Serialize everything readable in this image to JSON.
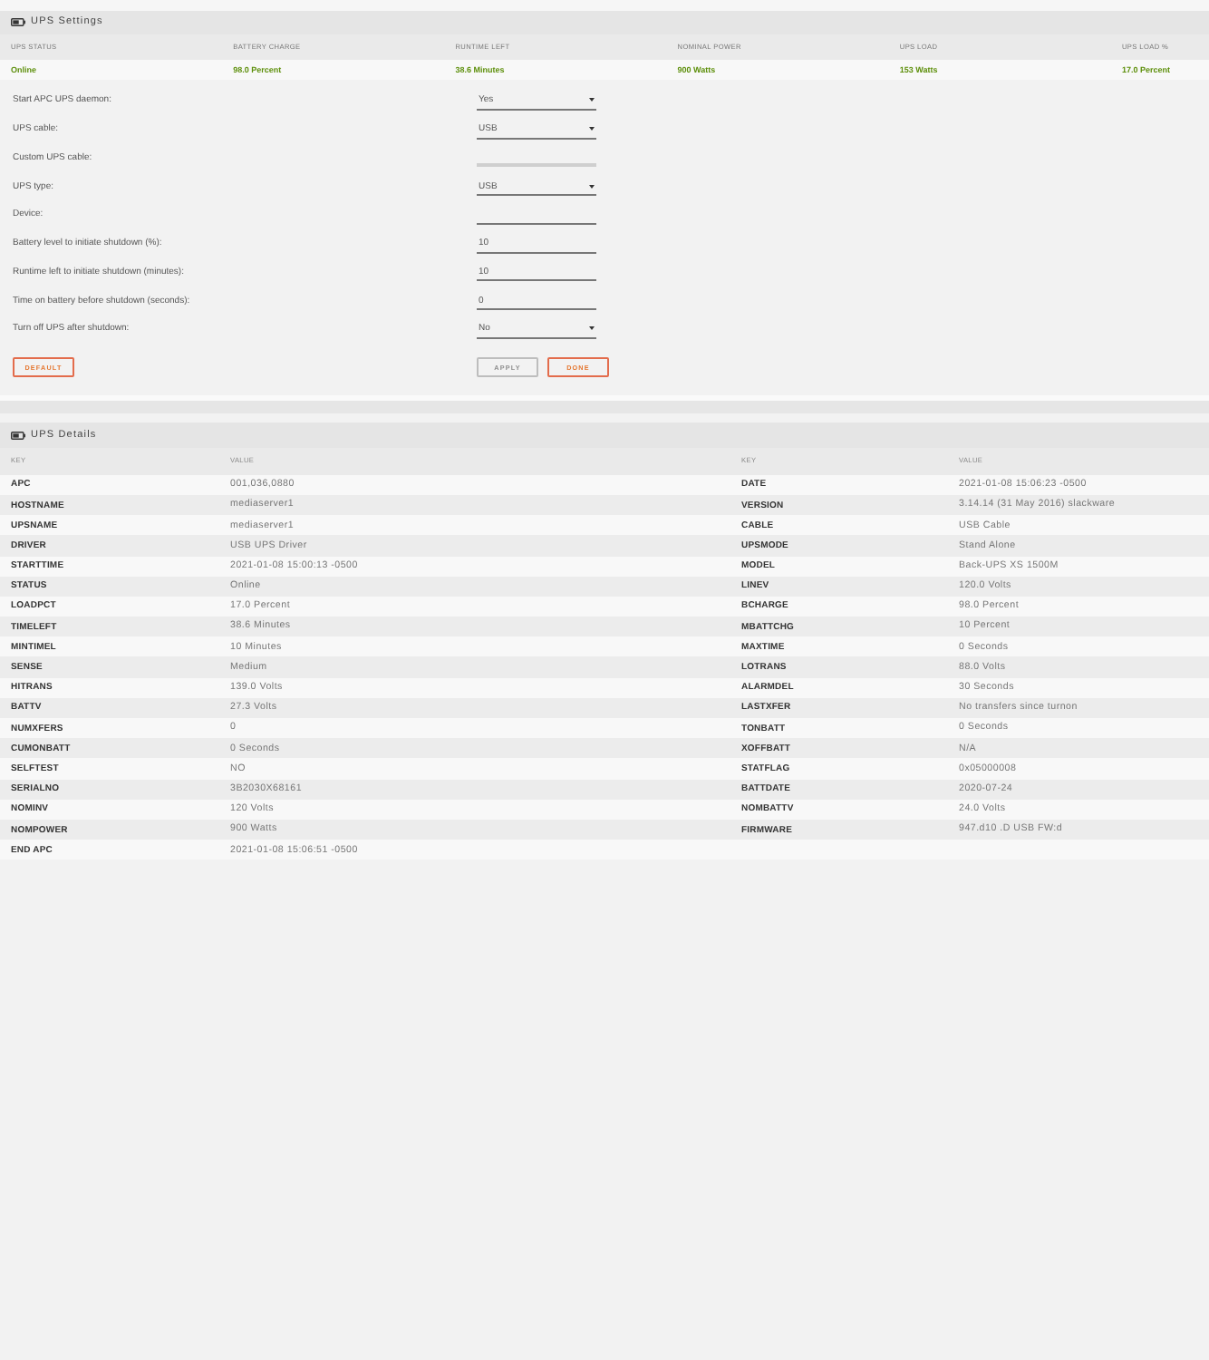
{
  "settings_panel": {
    "title": "UPS Settings",
    "status": [
      {
        "label": "UPS STATUS",
        "value": "Online"
      },
      {
        "label": "BATTERY CHARGE",
        "value": "98.0 Percent"
      },
      {
        "label": "RUNTIME LEFT",
        "value": "38.6 Minutes"
      },
      {
        "label": "NOMINAL POWER",
        "value": "900 Watts"
      },
      {
        "label": "UPS LOAD",
        "value": "153 Watts"
      },
      {
        "label": "UPS LOAD %",
        "value": "17.0 Percent"
      }
    ],
    "fields": [
      {
        "label": "Start APC UPS daemon:",
        "kind": "select",
        "value": "Yes",
        "disabled": false
      },
      {
        "label": "UPS cable:",
        "kind": "select",
        "value": "USB",
        "disabled": false
      },
      {
        "label": "Custom UPS cable:",
        "kind": "input",
        "disabled": true
      },
      {
        "label": "UPS type:",
        "kind": "select",
        "value": "USB",
        "disabled": false
      },
      {
        "label": "Device:",
        "kind": "input",
        "disabled": false
      },
      {
        "label": "Battery level to initiate shutdown (%):",
        "kind": "input",
        "value": "10",
        "disabled": false
      },
      {
        "label": "Runtime left to initiate shutdown (minutes):",
        "kind": "input",
        "value": "10",
        "disabled": false
      },
      {
        "label": "Time on battery before shutdown (seconds):",
        "kind": "input",
        "value": "0",
        "disabled": false
      },
      {
        "label": "Turn off UPS after shutdown:",
        "kind": "select",
        "value": "No",
        "disabled": false
      }
    ],
    "buttons": [
      {
        "label": "DEFAULT",
        "disabled": false
      },
      {
        "label": "APPLY",
        "disabled": true
      },
      {
        "label": "DONE",
        "disabled": false
      }
    ]
  },
  "details_panel": {
    "title": "UPS Details",
    "columns": [
      "KEY",
      "VALUE",
      "KEY",
      "VALUE"
    ],
    "rows": [
      {
        "cells": [
          "APC",
          "001,036,0880",
          "DATE",
          "2021-01-08 15:06:23 -0500"
        ]
      },
      {
        "cells": [
          "HOSTNAME",
          "mediaserver1",
          "VERSION",
          "3.14.14 (31 May 2016) slackware"
        ]
      },
      {
        "cells": [
          "UPSNAME",
          "mediaserver1",
          "CABLE",
          "USB Cable"
        ]
      },
      {
        "cells": [
          "DRIVER",
          "USB UPS Driver",
          "UPSMODE",
          "Stand Alone"
        ]
      },
      {
        "cells": [
          "STARTTIME",
          "2021-01-08 15:00:13 -0500",
          "MODEL",
          "Back-UPS XS 1500M"
        ]
      },
      {
        "cells": [
          "STATUS",
          "Online",
          "LINEV",
          "120.0 Volts"
        ]
      },
      {
        "cells": [
          "LOADPCT",
          "17.0 Percent",
          "BCHARGE",
          "98.0 Percent"
        ]
      },
      {
        "cells": [
          "TIMELEFT",
          "38.6 Minutes",
          "MBATTCHG",
          "10 Percent"
        ]
      },
      {
        "cells": [
          "MINTIMEL",
          "10 Minutes",
          "MAXTIME",
          "0 Seconds"
        ]
      },
      {
        "cells": [
          "SENSE",
          "Medium",
          "LOTRANS",
          "88.0 Volts"
        ]
      },
      {
        "cells": [
          "HITRANS",
          "139.0 Volts",
          "ALARMDEL",
          "30 Seconds"
        ]
      },
      {
        "cells": [
          "BATTV",
          "27.3 Volts",
          "LASTXFER",
          "No transfers since turnon"
        ]
      },
      {
        "cells": [
          "NUMXFERS",
          "0",
          "TONBATT",
          "0 Seconds"
        ]
      },
      {
        "cells": [
          "CUMONBATT",
          "0 Seconds",
          "XOFFBATT",
          "N/A"
        ]
      },
      {
        "cells": [
          "SELFTEST",
          "NO",
          "STATFLAG",
          "0x05000008"
        ]
      },
      {
        "cells": [
          "SERIALNO",
          "3B2030X68161",
          "BATTDATE",
          "2020-07-24"
        ]
      },
      {
        "cells": [
          "NOMINV",
          "120 Volts",
          "NOMBATTV",
          "24.0 Volts"
        ]
      },
      {
        "cells": [
          "NOMPOWER",
          "900 Watts",
          "FIRMWARE",
          "947.d10 .D USB FW:d"
        ]
      },
      {
        "cells": [
          "END APC",
          "2021-01-08 15:06:51 -0500"
        ]
      }
    ]
  }
}
